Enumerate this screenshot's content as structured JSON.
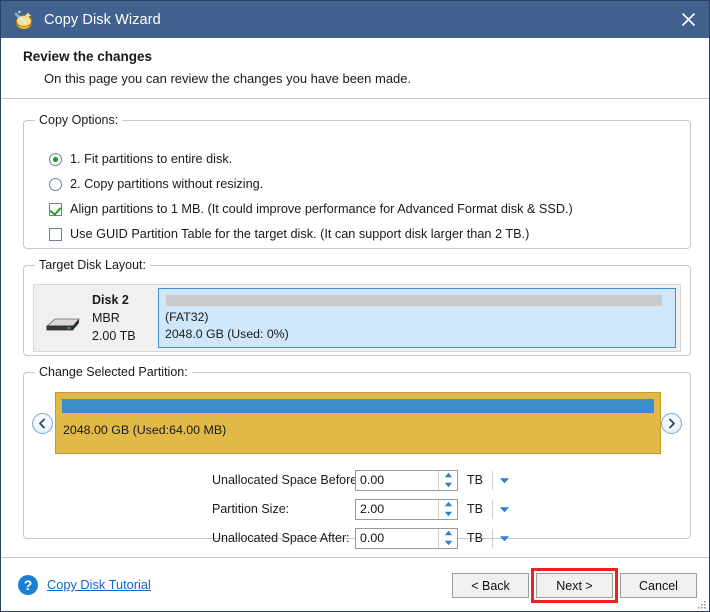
{
  "window": {
    "title": "Copy Disk Wizard",
    "app_icon": "disk-wand-icon",
    "close_icon": "close-icon",
    "titlebar_color": "#41618f"
  },
  "header": {
    "title": "Review the changes",
    "subtitle": "On this page you can review the changes you have been made."
  },
  "copy_options": {
    "legend": "Copy Options:",
    "items": [
      {
        "type": "radio",
        "checked": true,
        "label": "1. Fit partitions to entire disk."
      },
      {
        "type": "radio",
        "checked": false,
        "label": "2. Copy partitions without resizing."
      },
      {
        "type": "checkbox",
        "checked": true,
        "label": "Align partitions to 1 MB.  (It could improve performance for Advanced Format disk & SSD.)"
      },
      {
        "type": "checkbox",
        "checked": false,
        "label": "Use GUID Partition Table for the target disk. (It can support disk larger than 2 TB.)"
      }
    ]
  },
  "target_disk_layout": {
    "legend": "Target Disk Layout:",
    "disk": {
      "name": "Disk 2",
      "scheme": "MBR",
      "capacity": "2.00 TB",
      "icon": "hard-disk-icon"
    },
    "partition": {
      "filesystem": "(FAT32)",
      "size_used": "2048.0 GB (Used: 0%)",
      "fill_color": "#cfe7fa",
      "border_color": "#3f8fd0",
      "used_bar_color": "#c9c9c9"
    }
  },
  "change_selected_partition": {
    "legend": "Change Selected Partition:",
    "prev_icon": "chevron-left-icon",
    "next_icon": "chevron-right-icon",
    "partition": {
      "label": "2048.00 GB (Used:64.00 MB)",
      "fill_color": "#e0b949",
      "border_color": "#c89a2b",
      "used_bar_color": "#3c8dc8"
    },
    "fields": [
      {
        "label": "Unallocated Space Before:",
        "value": "0.00",
        "unit": "TB"
      },
      {
        "label": "Partition Size:",
        "value": "2.00",
        "unit": "TB"
      },
      {
        "label": "Unallocated Space After:",
        "value": "0.00",
        "unit": "TB"
      }
    ],
    "spinner_up_icon": "spinner-up-icon",
    "spinner_down_icon": "spinner-down-icon",
    "unit_dropdown_icon": "chevron-down-icon"
  },
  "footer": {
    "help_icon": "question-mark-icon",
    "tutorial_link": "Copy Disk Tutorial",
    "buttons": {
      "back": "< Back",
      "next": "Next >",
      "cancel": "Cancel"
    },
    "highlight_color": "#f02020",
    "highlighted_button": "Next >"
  }
}
